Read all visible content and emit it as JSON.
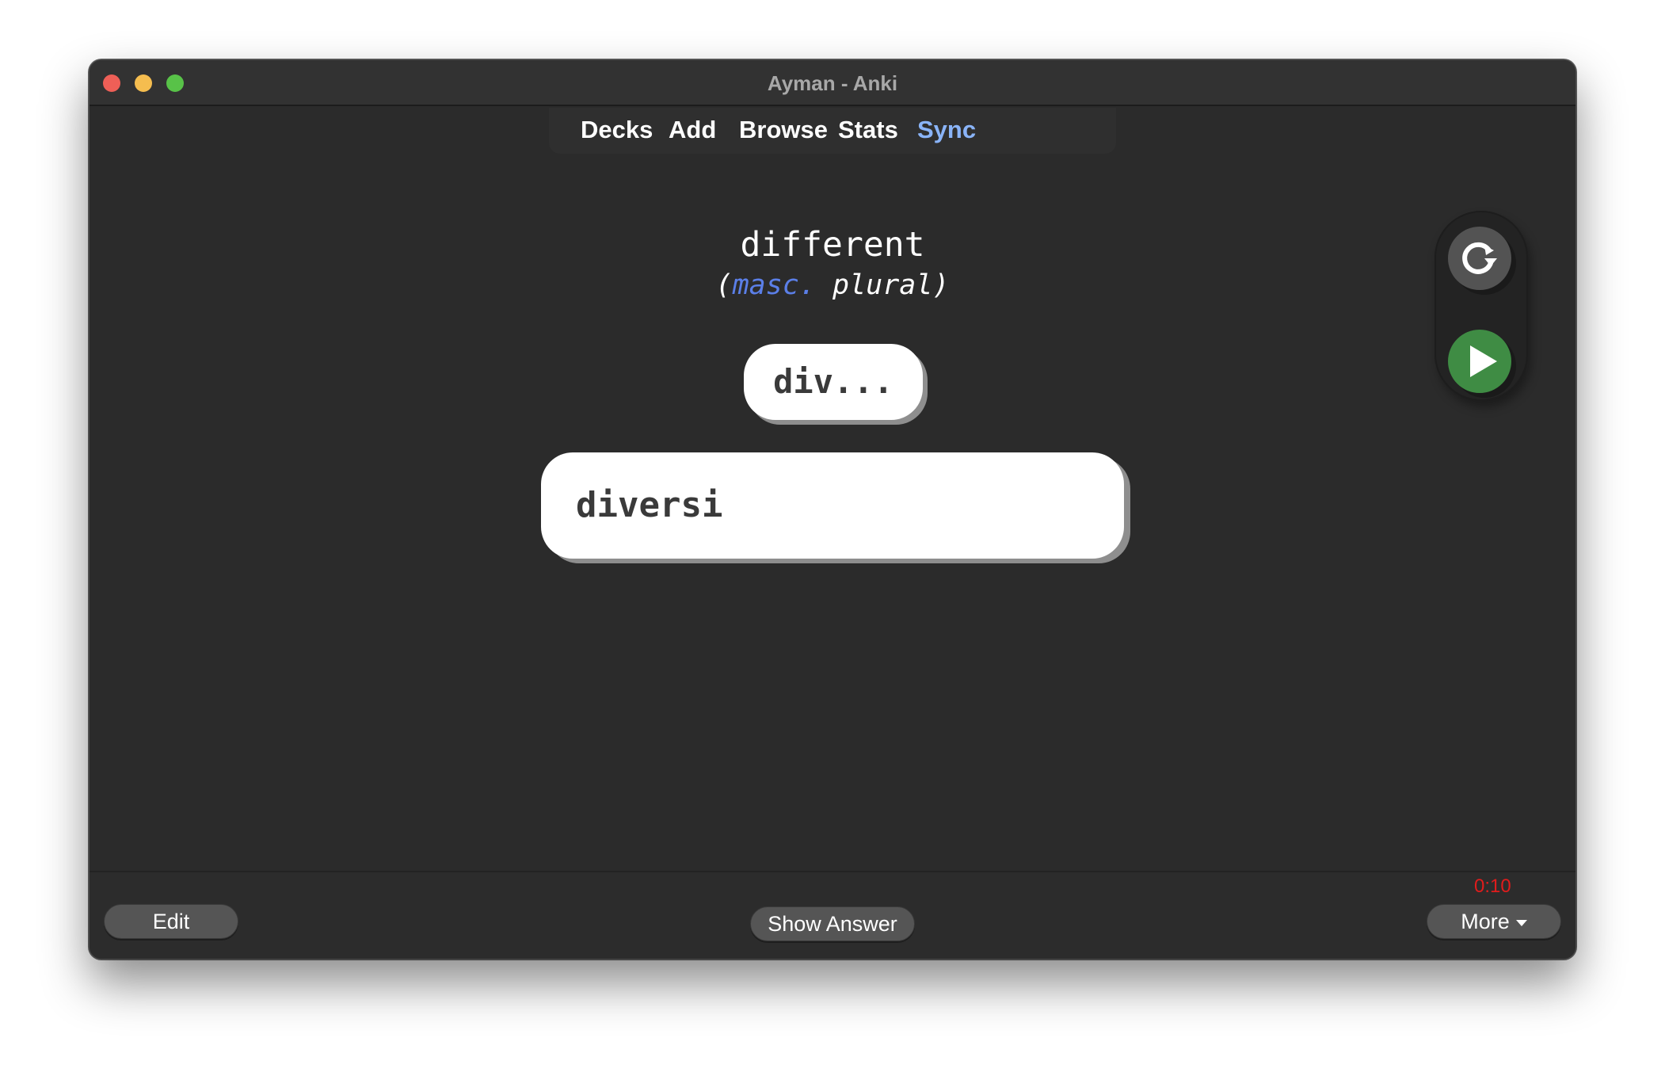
{
  "window": {
    "title": "Ayman - Anki"
  },
  "toolbar": {
    "items": [
      {
        "label": "Decks"
      },
      {
        "label": "Add"
      },
      {
        "label": "Browse"
      },
      {
        "label": "Stats"
      },
      {
        "label": "Sync"
      }
    ],
    "sync_color": "#8ab4f8"
  },
  "card": {
    "prompt": "different",
    "subline_open": "(",
    "subline_gender": "masc.",
    "subline_rest": " plural)",
    "gender_color": "#5b7fe8",
    "hint": "div...",
    "answer_value": "diversi"
  },
  "side_controls": {
    "replay_icon": "replay-icon",
    "play_icon": "play-icon",
    "play_color": "#3f8c44"
  },
  "bottom": {
    "edit_label": "Edit",
    "show_answer_label": "Show Answer",
    "more_label": "More",
    "timer": "0:10",
    "timer_color": "#e11c1c"
  }
}
